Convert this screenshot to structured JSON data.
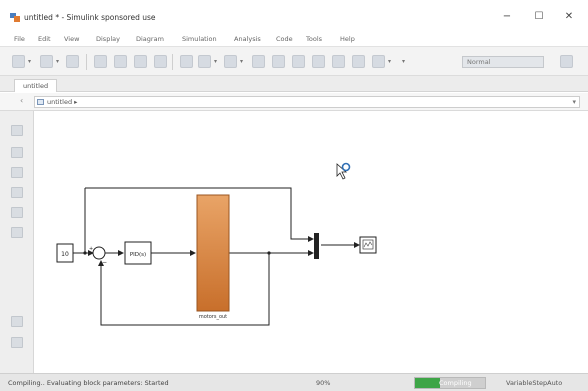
{
  "window": {
    "title": "untitled * - Simulink sponsored use",
    "controls": {
      "minimize": "−",
      "maximize": "☐",
      "close": "✕"
    }
  },
  "menu": {
    "items": [
      "File",
      "Edit",
      "View",
      "Display",
      "Diagram",
      "Simulation",
      "Analysis",
      "Code",
      "Tools",
      "Help"
    ]
  },
  "toolbar": {
    "stop_time": "Normal"
  },
  "tabs": [
    {
      "label": "untitled",
      "active": true
    }
  ],
  "address": {
    "path": "untitled ▸"
  },
  "diagram": {
    "constant_value": "10",
    "pid_label": "PID(s)",
    "subsystem_name": "motors_out",
    "colors": {
      "subsystem_top": "#e9a467",
      "subsystem_bottom": "#c86f2b",
      "signal_line": "#222222",
      "cursor_blue": "#2f6fb5"
    }
  },
  "status": {
    "message": "Compiling.. Evaluating block parameters: Started",
    "zoom": "90%",
    "progress_label": "Compiling",
    "progress_fraction": 0.35,
    "solver": "VariableStepAuto"
  },
  "colors": {
    "toolbar_bg": "#f3f3f3",
    "progress_green": "#3ea547"
  }
}
